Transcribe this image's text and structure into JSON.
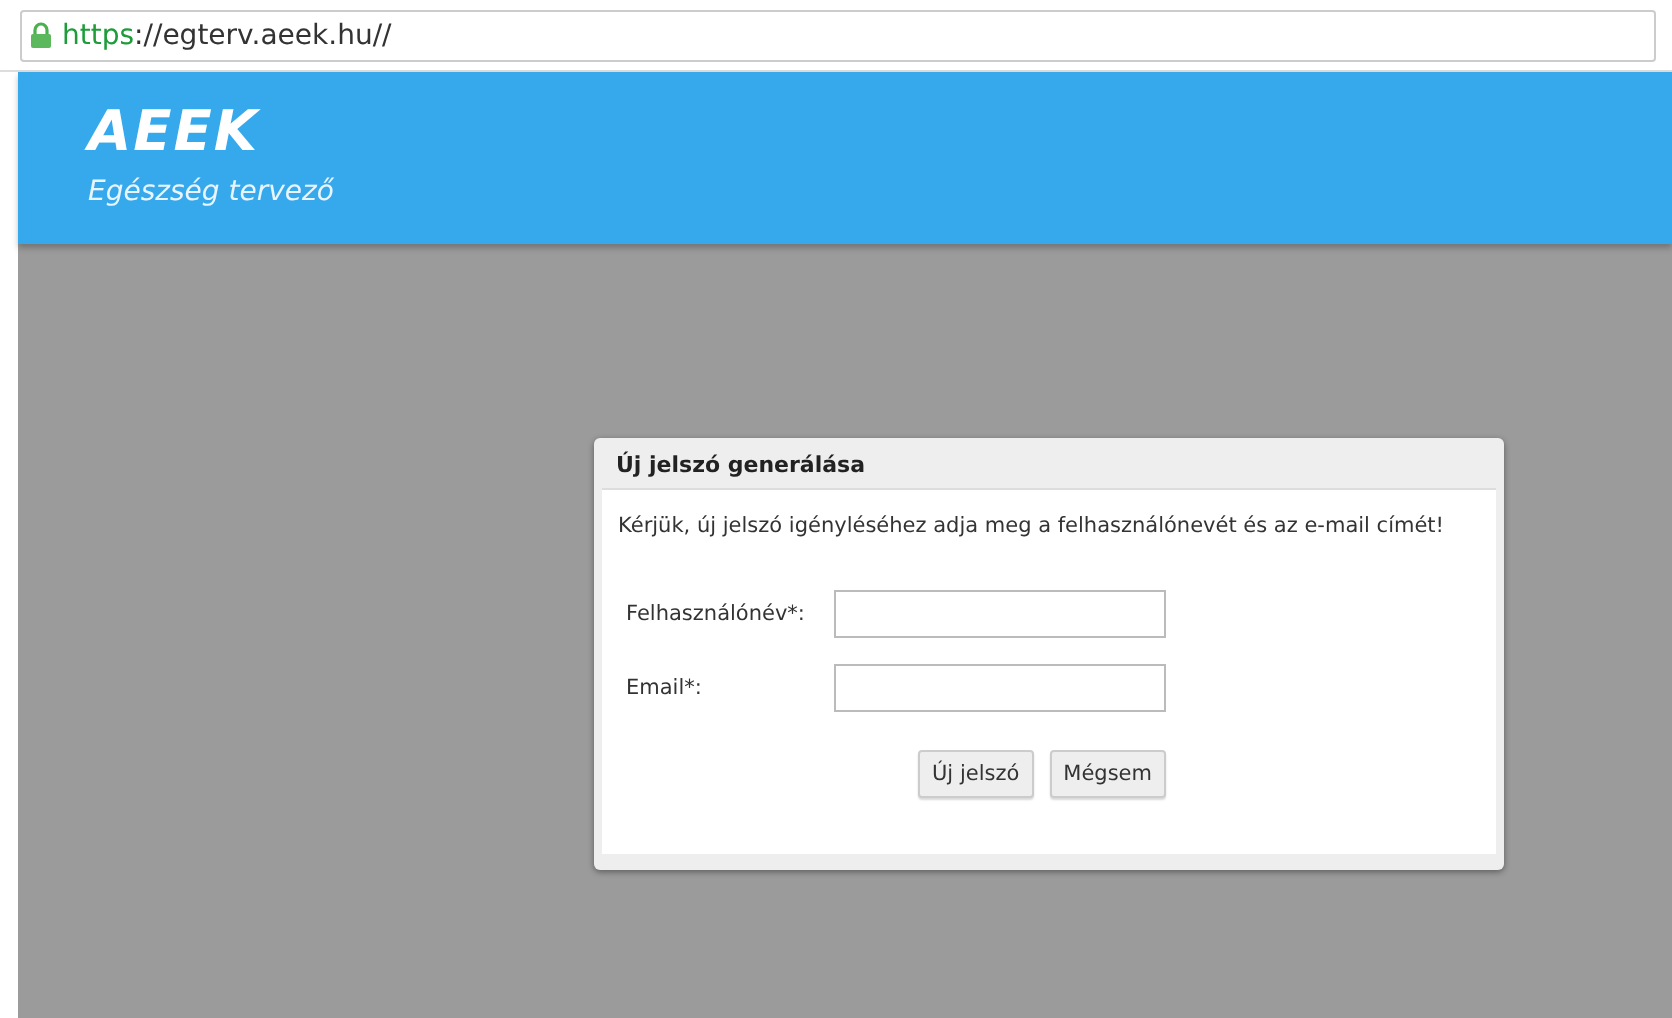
{
  "address_bar": {
    "scheme": "https",
    "rest": "://egterv.aeek.hu//"
  },
  "header": {
    "logo": "AEEK",
    "subtitle": "Egészség tervező"
  },
  "dialog": {
    "title": "Új jelszó generálása",
    "message": "Kérjük, új jelszó igényléséhez adja meg a felhasználónevét és az e-mail címét!",
    "fields": [
      {
        "label": "Felhasználónév*:"
      },
      {
        "label": "Email*:"
      }
    ],
    "buttons": [
      "Új jelszó",
      "Mégsem"
    ]
  }
}
